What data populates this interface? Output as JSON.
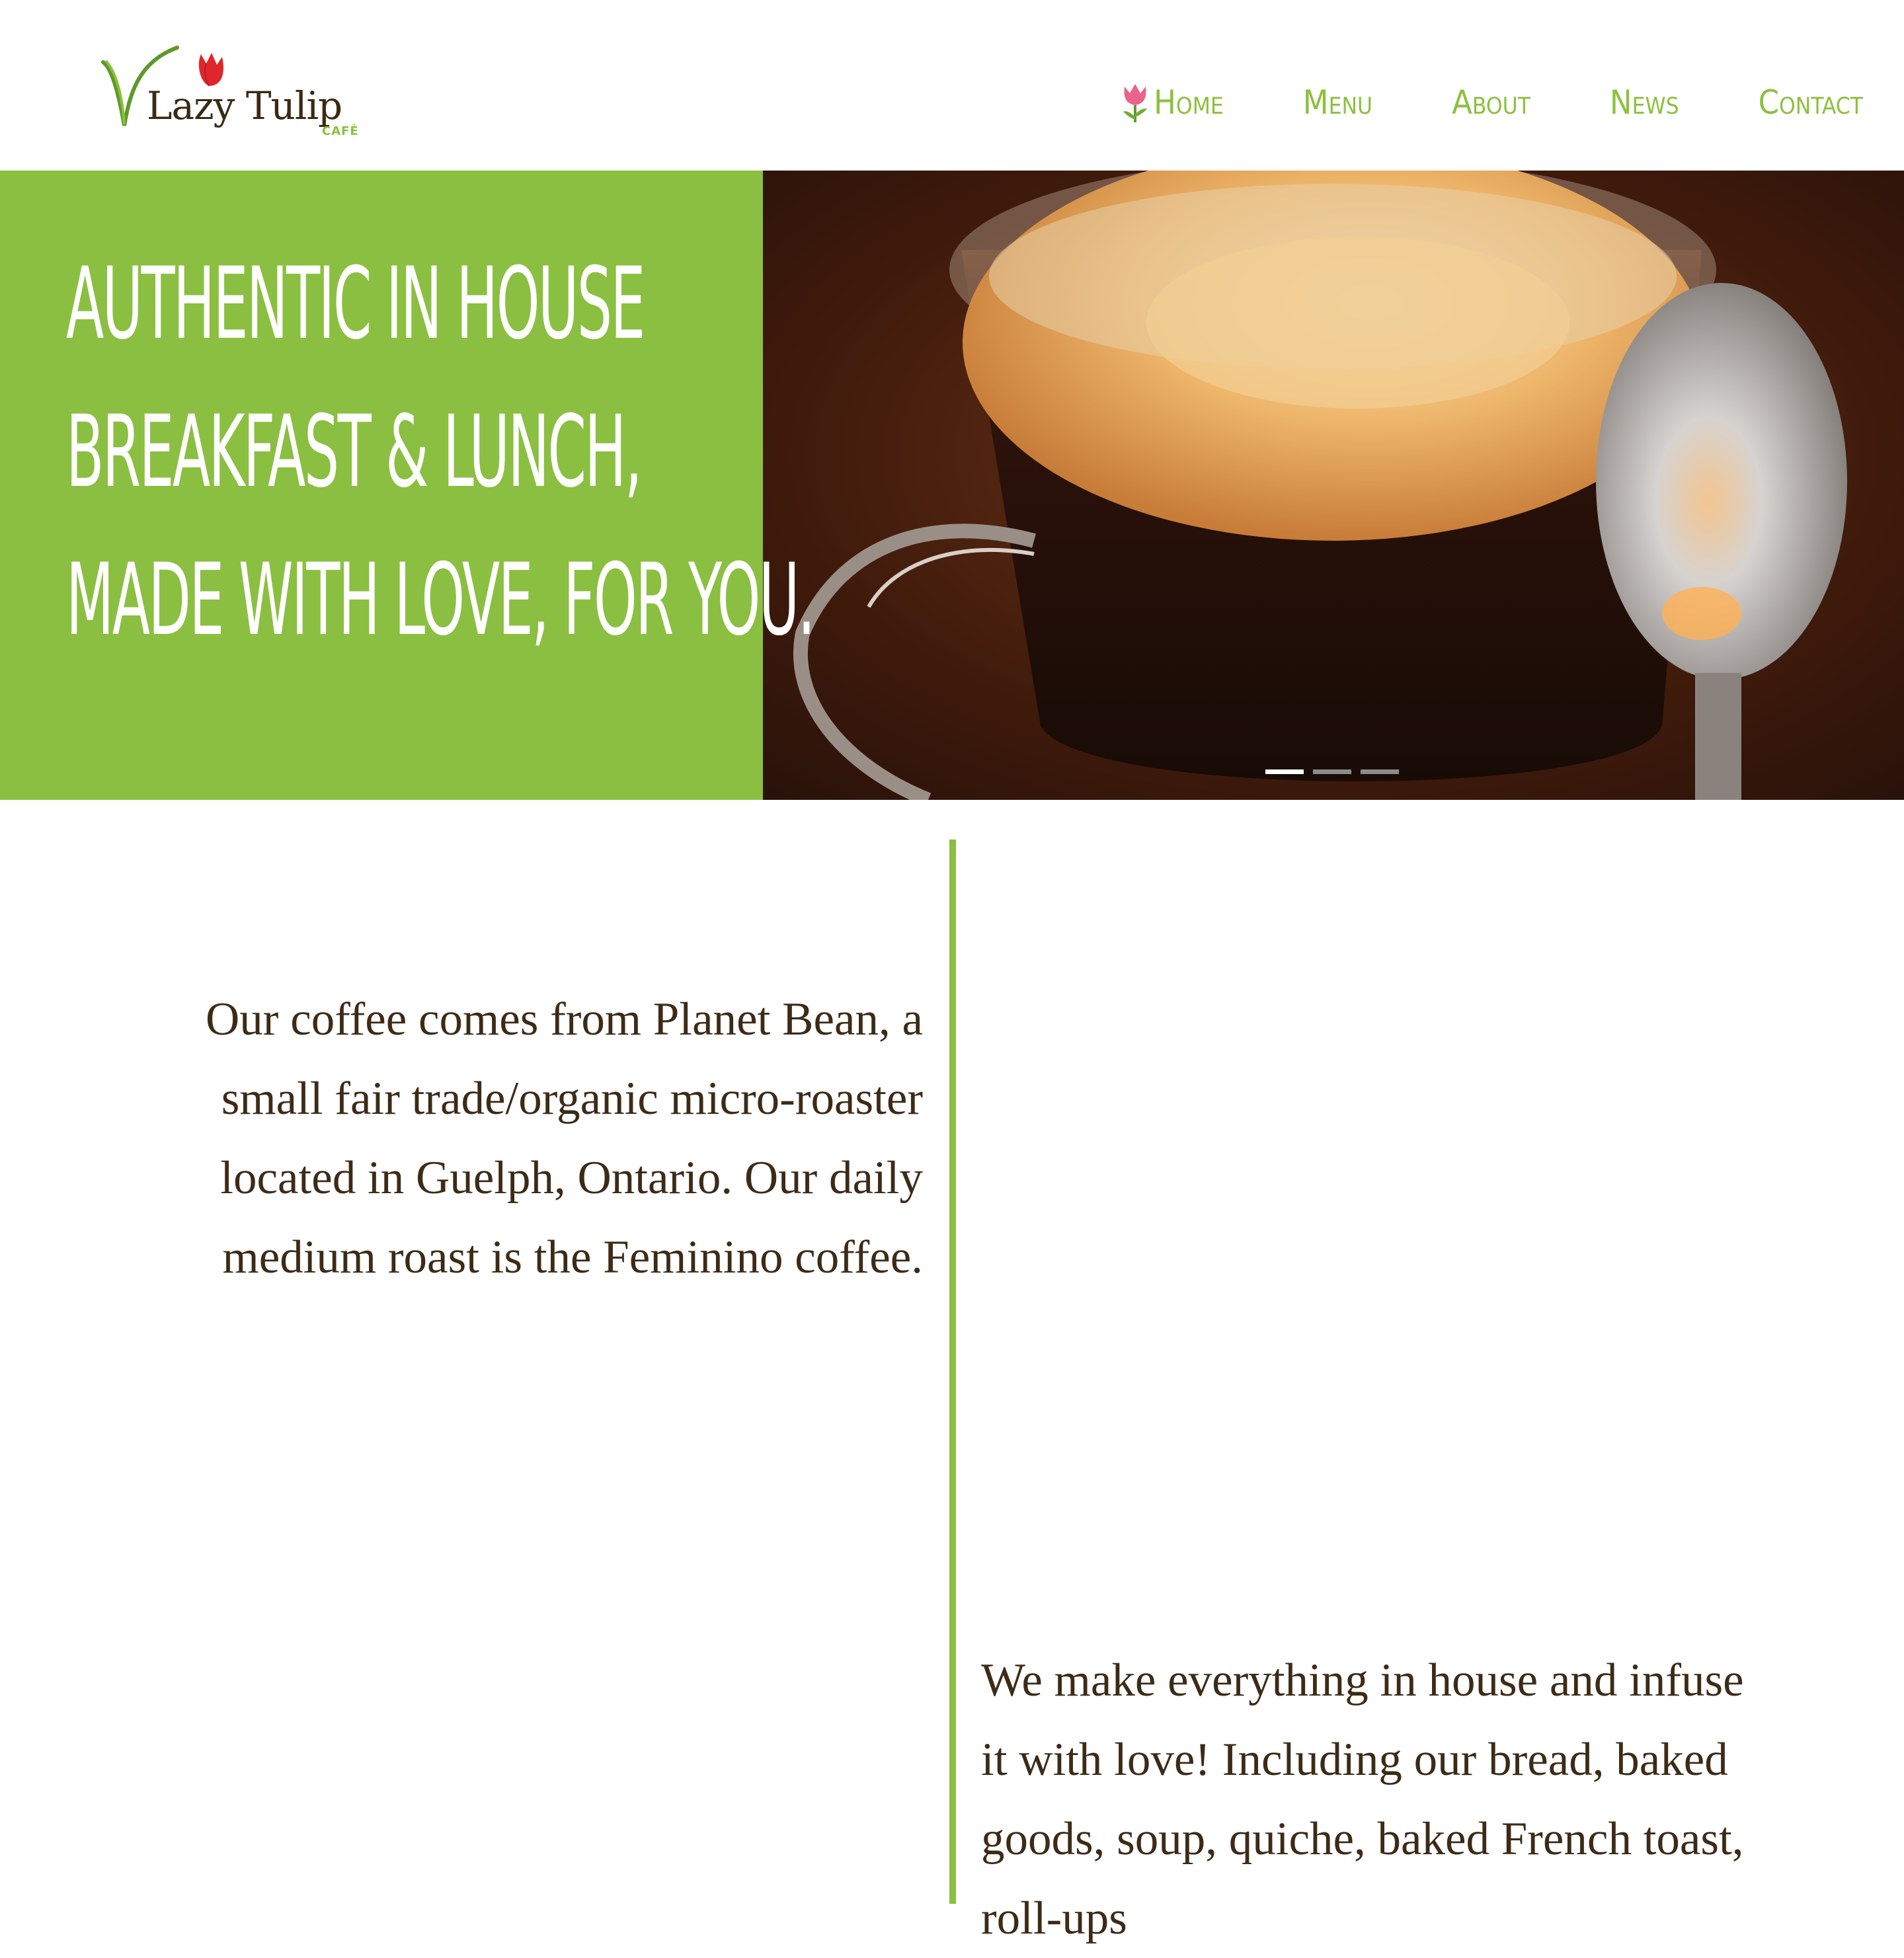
{
  "brand": {
    "name": "Lazy Tulip",
    "sub": "CAFÉ"
  },
  "nav": {
    "items": [
      {
        "label": "Home",
        "icon": "tulip-icon"
      },
      {
        "label": "Menu"
      },
      {
        "label": "About"
      },
      {
        "label": "News"
      },
      {
        "label": "Contact"
      }
    ]
  },
  "hero": {
    "title_lines": [
      "AUTHENTIC IN HOUSE",
      "BREAKFAST & LUNCH,",
      "MADE WITH LOVE, FOR YOU."
    ],
    "slides_total": 3,
    "active_slide": 1
  },
  "content": {
    "paragraph_left": "Our coffee comes from Planet Bean, a small fair trade/organic micro-roaster located in Guelph, Ontario. Our daily medium roast is the Feminino coffee.",
    "paragraph_right": "We make everything in house and infuse it with love! Including our bread, baked goods, soup, quiche, baked French toast, roll-ups"
  },
  "colors": {
    "accent_green": "#8bbf41",
    "text_brown": "#3d2b17",
    "tulip_red": "#e0262d"
  }
}
